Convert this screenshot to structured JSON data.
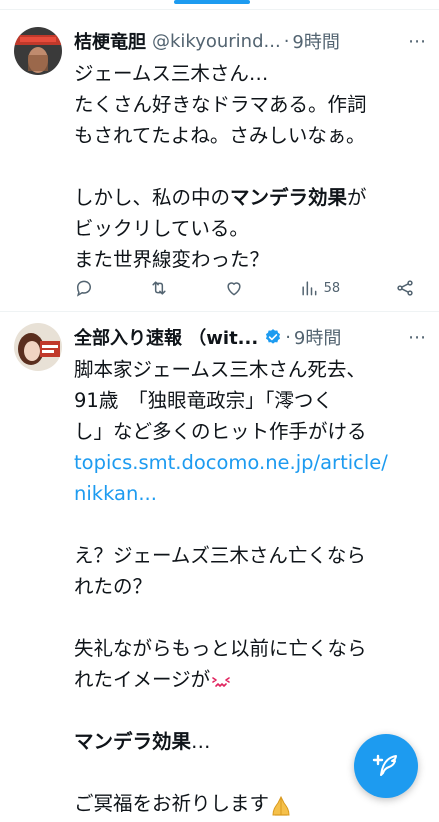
{
  "tweets": [
    {
      "name": "桔梗竜胆",
      "handle": "@kikyourind...",
      "separator": "·",
      "time": "9時間",
      "lines": [
        [
          {
            "text": "ジェームス三木さん…"
          }
        ],
        [
          {
            "text": "たくさん好きなドラマある。作詞"
          }
        ],
        [
          {
            "text": "もされてたよね。さみしいなぁ。"
          }
        ],
        [
          {
            "text": ""
          }
        ],
        [
          {
            "text": "しかし、私の中の"
          },
          {
            "text": "マンデラ効果",
            "style": "bold"
          },
          {
            "text": "が"
          }
        ],
        [
          {
            "text": "ビックリしている。"
          }
        ],
        [
          {
            "text": "また世界線変わった？"
          }
        ]
      ],
      "stats": {
        "views": "58"
      }
    },
    {
      "name": "全部入り速報 （wit...",
      "separator": "·",
      "time": "9時間",
      "lines": [
        [
          {
            "text": "脚本家ジェームス三木さん死去、"
          }
        ],
        [
          {
            "text": "91歳　「独眼竜政宗」「澪つく"
          }
        ],
        [
          {
            "text": "し」など多くのヒット作手がける"
          }
        ],
        [
          {
            "text": "topics.smt.docomo.ne.jp/article/",
            "style": "link"
          }
        ],
        [
          {
            "text": "nikkan...",
            "style": "link"
          }
        ],
        [
          {
            "text": ""
          }
        ],
        [
          {
            "text": "え？ジェームズ三木さん亡くなら"
          }
        ],
        [
          {
            "text": "れたの？"
          }
        ],
        [
          {
            "text": ""
          }
        ],
        [
          {
            "text": "失礼ながらもっと以前に亡くなら"
          }
        ],
        [
          {
            "text": "れたイメージが"
          }
        ],
        [
          {
            "text": ""
          }
        ],
        [
          {
            "text": "マンデラ効果",
            "style": "bold"
          },
          {
            "text": "…"
          }
        ],
        [
          {
            "text": ""
          }
        ],
        [
          {
            "text": "ご冥福をお祈りします"
          }
        ]
      ]
    }
  ],
  "icons": [
    "more-icon",
    "reply-icon",
    "retweet-icon",
    "like-icon",
    "views-icon",
    "share-icon",
    "verified-badge-icon",
    "compose-icon",
    "confounded-emoji",
    "pray-emoji"
  ],
  "colors": {
    "accent": "#1d9bf0",
    "text": "#0f1419",
    "secondary": "#536471",
    "divider": "#eff3f4"
  }
}
